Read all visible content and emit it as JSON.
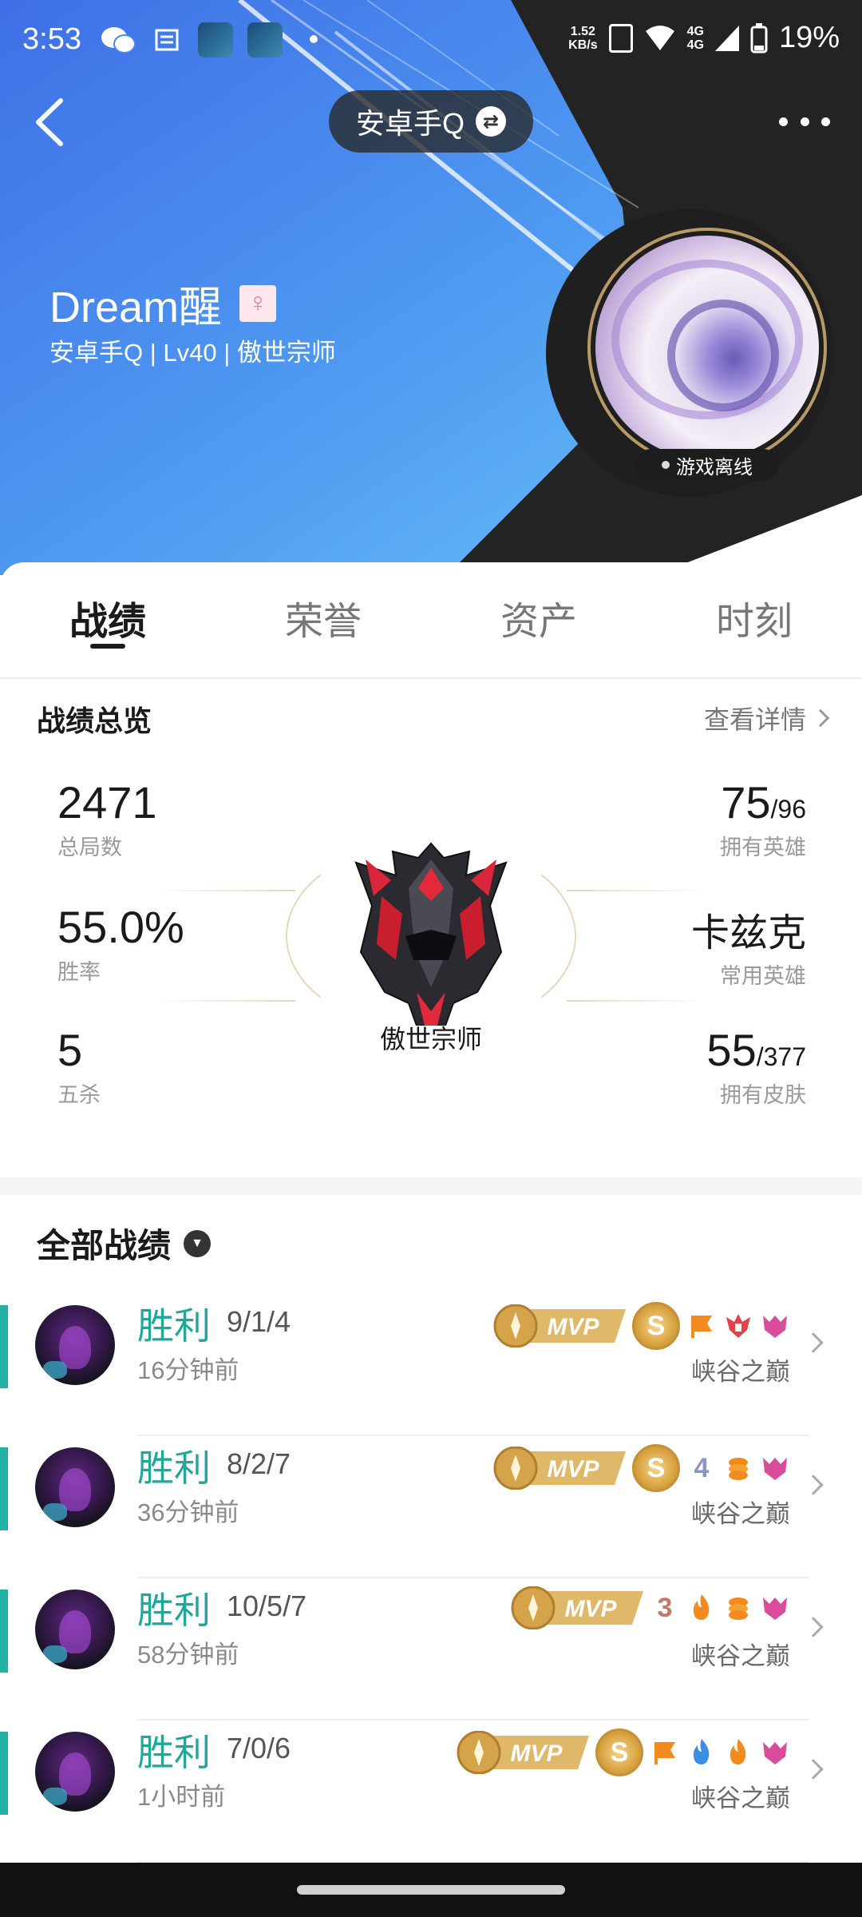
{
  "statusbar": {
    "time": "3:53",
    "net_speed_value": "1.52",
    "net_speed_unit": "KB/s",
    "network_label_1": "4G",
    "network_label_2": "4G",
    "battery": "19%"
  },
  "header": {
    "account_label": "安卓手Q",
    "username": "Dream醒",
    "subline": "安卓手Q | Lv40 | 傲世宗师",
    "online_status": "游戏离线"
  },
  "tabs": [
    {
      "label": "战绩",
      "active": true
    },
    {
      "label": "荣誉",
      "active": false
    },
    {
      "label": "资产",
      "active": false
    },
    {
      "label": "时刻",
      "active": false
    }
  ],
  "overview": {
    "title": "战绩总览",
    "details_link": "查看详情",
    "total_games": {
      "value": "2471",
      "label": "总局数"
    },
    "win_rate": {
      "value": "55.0%",
      "label": "胜率"
    },
    "penta_kills": {
      "value": "5",
      "label": "五杀"
    },
    "heroes_owned": {
      "value": "75",
      "total": "/96",
      "label": "拥有英雄"
    },
    "common_hero": {
      "value": "卡兹克",
      "label": "常用英雄"
    },
    "skins_owned": {
      "value": "55",
      "total": "/377",
      "label": "拥有皮肤"
    },
    "rank_name": "傲世宗师"
  },
  "matches_section": {
    "title": "全部战绩",
    "items": [
      {
        "result": "胜利",
        "kda": "9/1/4",
        "time_ago": "16分钟前",
        "mode": "峡谷之巅",
        "mvp": "MVP",
        "s_rank": "S"
      },
      {
        "result": "胜利",
        "kda": "8/2/7",
        "time_ago": "36分钟前",
        "mode": "峡谷之巅",
        "mvp": "MVP",
        "s_rank": "S",
        "multikill": "4"
      },
      {
        "result": "胜利",
        "kda": "10/5/7",
        "time_ago": "58分钟前",
        "mode": "峡谷之巅",
        "mvp": "MVP",
        "multikill": "3"
      },
      {
        "result": "胜利",
        "kda": "7/0/6",
        "time_ago": "1小时前",
        "mode": "峡谷之巅",
        "mvp": "MVP",
        "s_rank": "S"
      }
    ]
  },
  "colors": {
    "win_green": "#22a69a",
    "win_bar": "#22b2a3",
    "mvp_gold": "#d9a442",
    "badge_orange": "#f28a1e",
    "badge_pink": "#d94c9c",
    "badge_red": "#e5414a"
  },
  "icons": [
    "back-arrow-icon",
    "swap-icon",
    "more-icon",
    "female-icon",
    "chevron-right-icon",
    "dropdown-icon",
    "flag-icon",
    "tower-icon",
    "dragon-icon",
    "coin-icon",
    "fire-icon",
    "blue-buff-icon"
  ]
}
